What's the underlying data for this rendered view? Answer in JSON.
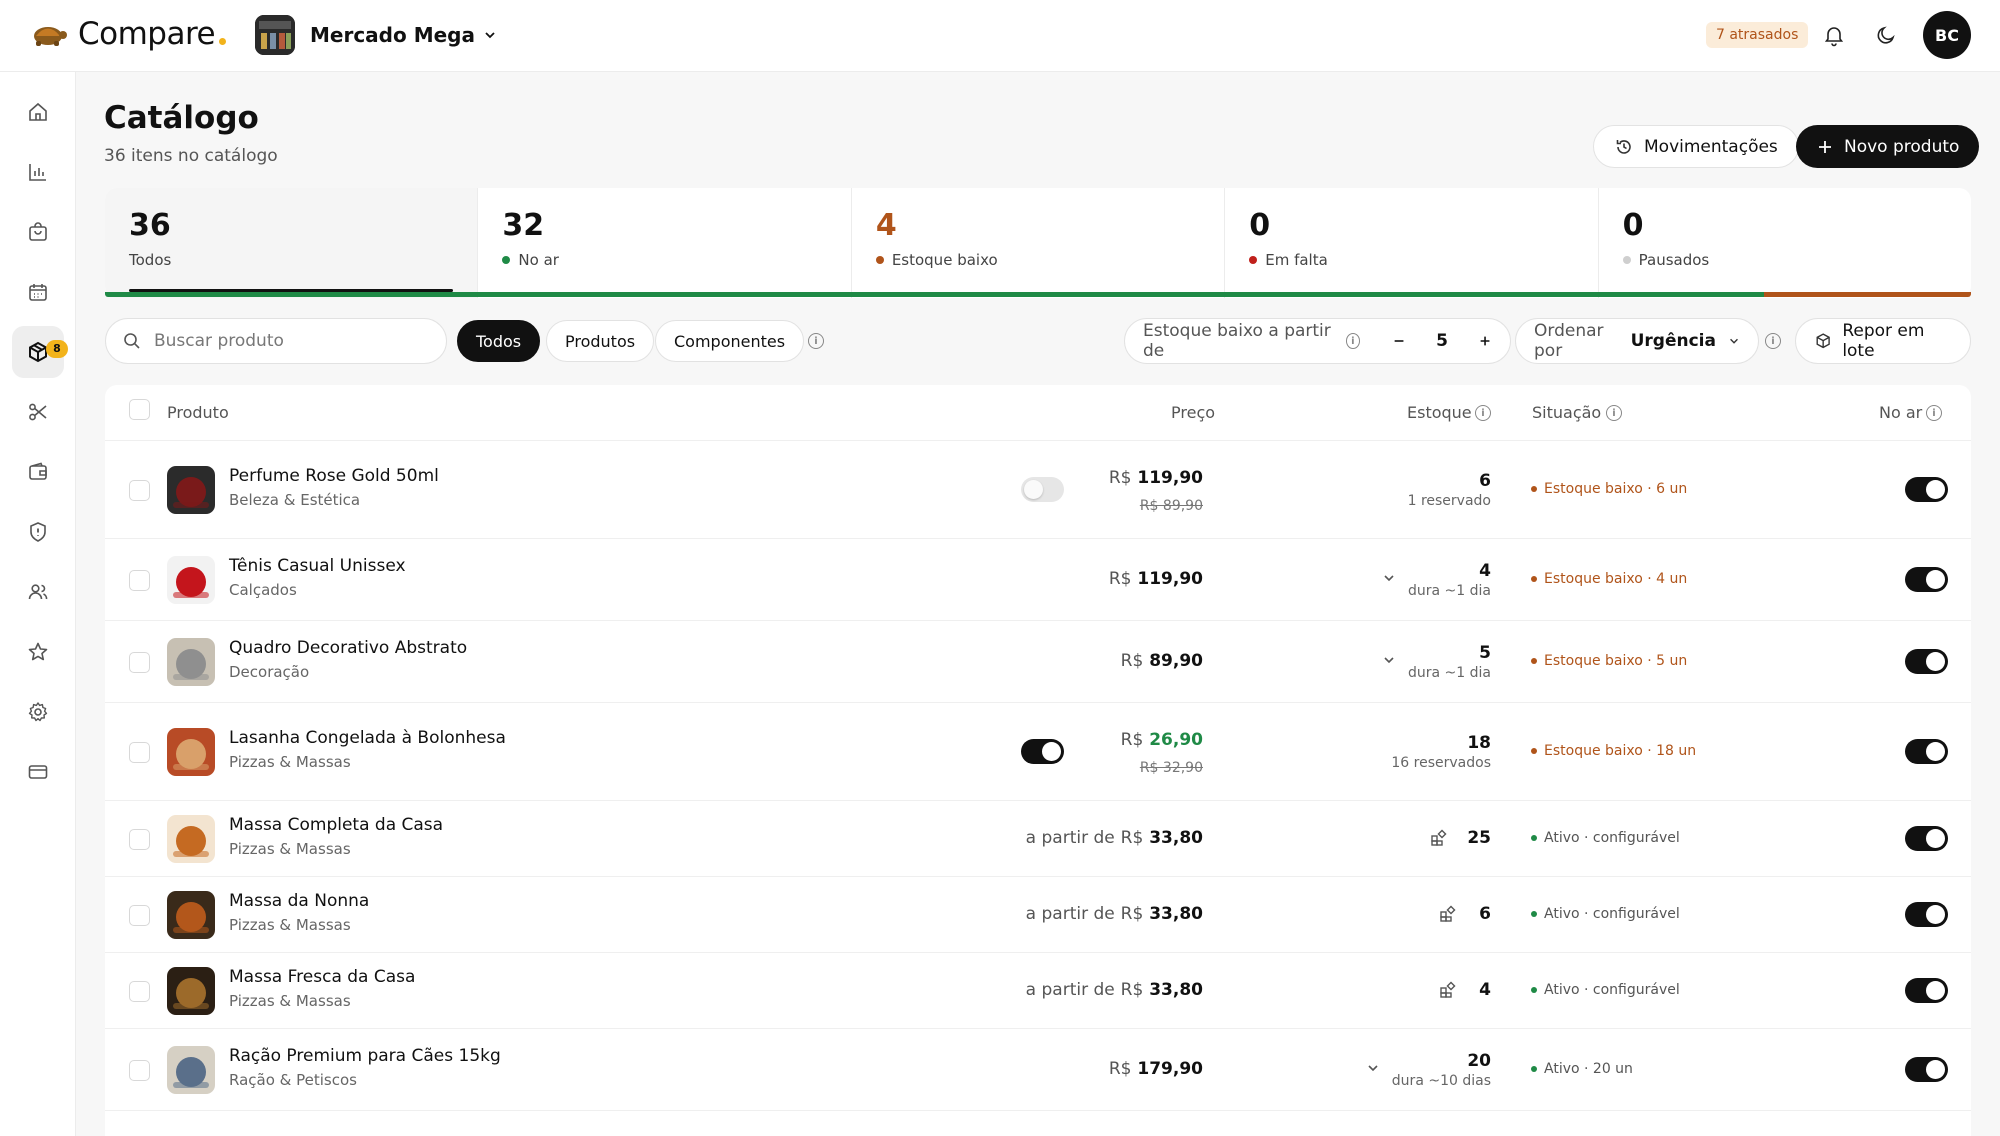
{
  "app": {
    "name": "Compare",
    "accent": "#f2b31b"
  },
  "store": {
    "name": "Mercado Mega"
  },
  "header": {
    "late_badge": "7 atrasados",
    "user_initials": "BC"
  },
  "sidebar": {
    "calendar_badge": "8",
    "active": "catalog"
  },
  "page": {
    "title": "Catálogo",
    "subtitle": "36 itens no catálogo"
  },
  "actions": {
    "movements": "Movimentações",
    "new_product": "Novo produto"
  },
  "stats": [
    {
      "value": "36",
      "label": "Todos"
    },
    {
      "value": "32",
      "label": "No ar",
      "color": "#1f8a46"
    },
    {
      "value": "4",
      "label": "Estoque baixo",
      "color": "#b0541a"
    },
    {
      "value": "0",
      "label": "Em falta",
      "color": "#c0201b"
    },
    {
      "value": "0",
      "label": "Pausados",
      "color": "#cfcfcf"
    }
  ],
  "stat_bar": [
    {
      "fraction": 0.889,
      "color": "#1f8a46"
    },
    {
      "fraction": 0.111,
      "color": "#b0541a"
    }
  ],
  "filters": {
    "search_placeholder": "Buscar produto",
    "tabs": [
      "Todos",
      "Produtos",
      "Componentes"
    ],
    "threshold_label": "Estoque baixo a partir de",
    "threshold_value": "5",
    "sort_label": "Ordenar por",
    "sort_value": "Urgência",
    "restock": "Repor em lote"
  },
  "table": {
    "columns": {
      "product": "Produto",
      "price": "Preço",
      "stock": "Estoque",
      "status": "Situação",
      "live": "No ar"
    },
    "rows": [
      {
        "name": "Perfume Rose Gold 50ml",
        "category": "Beleza & Estética",
        "currency": "R$",
        "price_prefix": "",
        "price": "119,90",
        "old_price": "R$ 89,90",
        "stock": "6",
        "stock_sub": "1 reservado",
        "status": "Estoque baixo · 6 un",
        "status_type": "low",
        "promo_toggle": "off",
        "expand": false,
        "configurable": false,
        "live": true
      },
      {
        "name": "Tênis Casual Unissex",
        "category": "Calçados",
        "currency": "R$",
        "price_prefix": "",
        "price": "119,90",
        "old_price": "",
        "stock": "4",
        "stock_sub": "dura ~1 dia",
        "status": "Estoque baixo · 4 un",
        "status_type": "low",
        "promo_toggle": "none",
        "expand": true,
        "configurable": false,
        "live": true
      },
      {
        "name": "Quadro Decorativo Abstrato",
        "category": "Decoração",
        "currency": "R$",
        "price_prefix": "",
        "price": "89,90",
        "old_price": "",
        "stock": "5",
        "stock_sub": "dura ~1 dia",
        "status": "Estoque baixo · 5 un",
        "status_type": "low",
        "promo_toggle": "none",
        "expand": true,
        "configurable": false,
        "live": true
      },
      {
        "name": "Lasanha Congelada à Bolonhesa",
        "category": "Pizzas & Massas",
        "currency": "R$",
        "price_prefix": "",
        "price": "26,90",
        "old_price": "R$ 32,90",
        "stock": "18",
        "stock_sub": "16 reservados",
        "status": "Estoque baixo · 18 un",
        "status_type": "low",
        "promo_toggle": "on",
        "expand": false,
        "configurable": false,
        "live": true,
        "price_color": "#1f8a46"
      },
      {
        "name": "Massa Completa da Casa",
        "category": "Pizzas & Massas",
        "currency": "R$",
        "price_prefix": "a partir de",
        "price": "33,80",
        "old_price": "",
        "stock": "25",
        "stock_sub": "",
        "status": "Ativo · configurável",
        "status_type": "ok",
        "promo_toggle": "none",
        "expand": false,
        "configurable": true,
        "live": true
      },
      {
        "name": "Massa da Nonna",
        "category": "Pizzas & Massas",
        "currency": "R$",
        "price_prefix": "a partir de",
        "price": "33,80",
        "old_price": "",
        "stock": "6",
        "stock_sub": "",
        "status": "Ativo · configurável",
        "status_type": "ok",
        "promo_toggle": "none",
        "expand": false,
        "configurable": true,
        "live": true
      },
      {
        "name": "Massa Fresca da Casa",
        "category": "Pizzas & Massas",
        "currency": "R$",
        "price_prefix": "a partir de",
        "price": "33,80",
        "old_price": "",
        "stock": "4",
        "stock_sub": "",
        "status": "Ativo · configurável",
        "status_type": "ok",
        "promo_toggle": "none",
        "expand": false,
        "configurable": true,
        "live": true
      },
      {
        "name": "Ração Premium para Cães 15kg",
        "category": "Ração & Petiscos",
        "currency": "R$",
        "price_prefix": "",
        "price": "179,90",
        "old_price": "",
        "stock": "20",
        "stock_sub": "dura ~10 dias",
        "status": "Ativo · 20 un",
        "status_type": "ok",
        "promo_toggle": "none",
        "expand": true,
        "configurable": false,
        "live": true
      }
    ]
  },
  "colors": {
    "low": "#b0541a",
    "ok": "#1f8a46",
    "dark": "#111111"
  }
}
